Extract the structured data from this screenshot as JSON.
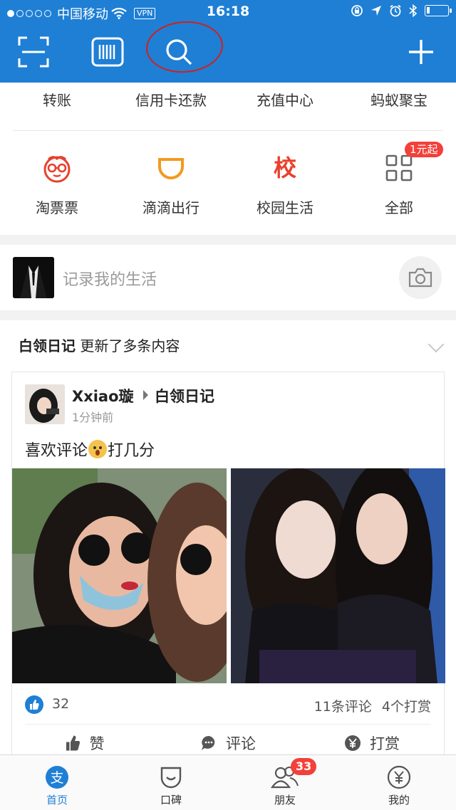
{
  "status_bar": {
    "carrier": "中国移动",
    "vpn": "VPN",
    "time": "16:18"
  },
  "toolbar": {
    "buttons": [
      "scan-icon",
      "barcode-icon",
      "search-icon",
      "plus-icon"
    ]
  },
  "quick_actions": [
    "转账",
    "信用卡还款",
    "充值中心",
    "蚂蚁聚宝"
  ],
  "apps": [
    {
      "label": "淘票票",
      "icon": "glasses-face-icon"
    },
    {
      "label": "滴滴出行",
      "icon": "didi-icon"
    },
    {
      "label": "校园生活",
      "icon_text": "校"
    },
    {
      "label": "全部",
      "icon": "grid-icon"
    }
  ],
  "apps_badge": "1元起",
  "record": {
    "placeholder": "记录我的生活"
  },
  "feed": {
    "source": "白领日记",
    "update_text": "更新了多条内容",
    "post": {
      "author": "Xxiao璇",
      "group": "白领日记",
      "time": "1分钟前",
      "text_before": "喜欢评论",
      "text_after": "打几分",
      "likes": "32",
      "comments": "11条评论",
      "tips": "4个打赏",
      "actions": {
        "like": "赞",
        "comment": "评论",
        "tip": "打赏"
      }
    }
  },
  "tabbar": [
    {
      "label": "首页",
      "icon": "alipay-icon",
      "active": true
    },
    {
      "label": "口碑",
      "icon": "koubei-icon"
    },
    {
      "label": "朋友",
      "icon": "friends-icon",
      "badge": "33"
    },
    {
      "label": "我的",
      "icon": "profile-icon"
    }
  ],
  "colors": {
    "brand_blue": "#1e7fd5",
    "badge_red": "#f3403a",
    "annotation_red": "#d2201c"
  }
}
